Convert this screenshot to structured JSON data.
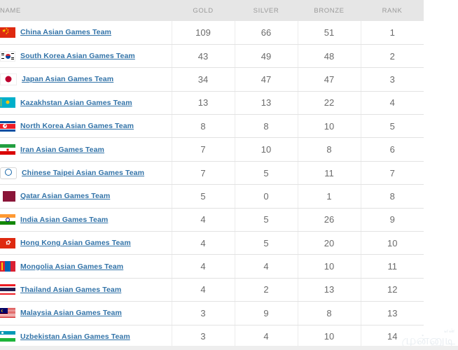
{
  "table": {
    "name": "asian-games-medal-table",
    "columns": [
      {
        "key": "name",
        "label": "NAME"
      },
      {
        "key": "gold",
        "label": "GOLD"
      },
      {
        "key": "silver",
        "label": "SILVER"
      },
      {
        "key": "bronze",
        "label": "BRONZE"
      },
      {
        "key": "rank",
        "label": "RANK"
      }
    ],
    "rows": [
      {
        "flag": "china-flag-icon",
        "name": "China Asian Games Team",
        "gold": "109",
        "silver": "66",
        "bronze": "51",
        "rank": "1"
      },
      {
        "flag": "south-korea-flag-icon",
        "name": "South Korea Asian Games Team",
        "gold": "43",
        "silver": "49",
        "bronze": "48",
        "rank": "2"
      },
      {
        "flag": "japan-flag-icon",
        "name": "Japan Asian Games Team",
        "gold": "34",
        "silver": "47",
        "bronze": "47",
        "rank": "3"
      },
      {
        "flag": "kazakhstan-flag-icon",
        "name": "Kazakhstan Asian Games Team",
        "gold": "13",
        "silver": "13",
        "bronze": "22",
        "rank": "4"
      },
      {
        "flag": "north-korea-flag-icon",
        "name": "North Korea Asian Games Team",
        "gold": "8",
        "silver": "8",
        "bronze": "10",
        "rank": "5"
      },
      {
        "flag": "iran-flag-icon",
        "name": "Iran Asian Games Team",
        "gold": "7",
        "silver": "10",
        "bronze": "8",
        "rank": "6"
      },
      {
        "flag": "chinese-taipei-flag-icon",
        "name": "Chinese Taipei Asian Games Team",
        "gold": "7",
        "silver": "5",
        "bronze": "11",
        "rank": "7"
      },
      {
        "flag": "qatar-flag-icon",
        "name": "Qatar Asian Games Team",
        "gold": "5",
        "silver": "0",
        "bronze": "1",
        "rank": "8"
      },
      {
        "flag": "india-flag-icon",
        "name": "India Asian Games Team",
        "gold": "4",
        "silver": "5",
        "bronze": "26",
        "rank": "9"
      },
      {
        "flag": "hong-kong-flag-icon",
        "name": "Hong Kong Asian Games Team",
        "gold": "4",
        "silver": "5",
        "bronze": "20",
        "rank": "10"
      },
      {
        "flag": "mongolia-flag-icon",
        "name": "Mongolia Asian Games Team",
        "gold": "4",
        "silver": "4",
        "bronze": "10",
        "rank": "11"
      },
      {
        "flag": "thailand-flag-icon",
        "name": "Thailand Asian Games Team",
        "gold": "4",
        "silver": "2",
        "bronze": "13",
        "rank": "12"
      },
      {
        "flag": "malaysia-flag-icon",
        "name": "Malaysia Asian Games Team",
        "gold": "3",
        "silver": "9",
        "bronze": "8",
        "rank": "13"
      },
      {
        "flag": "uzbekistan-flag-icon",
        "name": "Uzbekistan Asian Games Team",
        "gold": "3",
        "silver": "4",
        "bronze": "10",
        "rank": "14"
      }
    ]
  },
  "watermark": {
    "small_text": "என்",
    "main_text": "முன்னுடி"
  },
  "colors": {
    "header_background": "#e6e6e6",
    "header_text": "#9a9a9a",
    "team_link": "#3273a8",
    "value_text": "#6b6b6b",
    "row_divider": "#e2e2e2"
  }
}
